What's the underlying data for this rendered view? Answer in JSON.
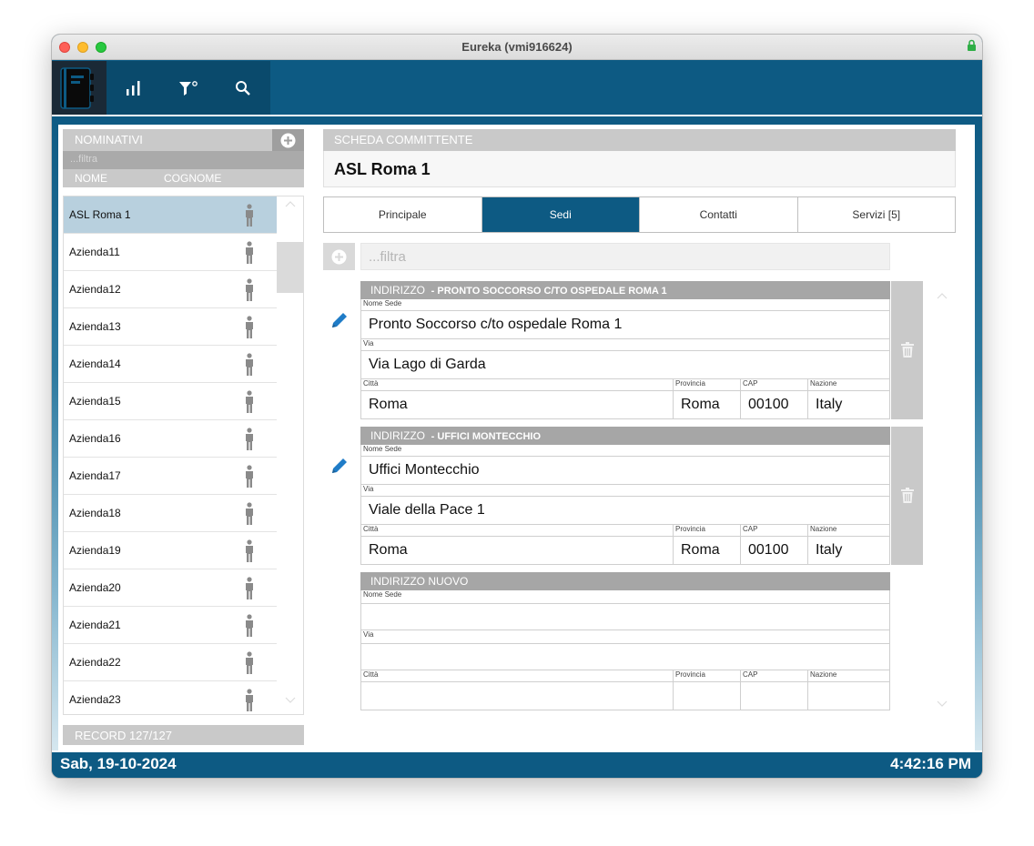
{
  "window": {
    "title": "Eureka (vmi916624)"
  },
  "toolbar": {
    "icons": [
      "notebook-icon",
      "bar-chart-icon",
      "filter-icon",
      "search-icon"
    ]
  },
  "left_panel": {
    "header": "NOMINATIVI",
    "filter_placeholder": "...filtra",
    "columns": [
      "NOME",
      "COGNOME"
    ],
    "rows": [
      "ASL Roma 1",
      "Azienda11",
      "Azienda12",
      "Azienda13",
      "Azienda14",
      "Azienda15",
      "Azienda16",
      "Azienda17",
      "Azienda18",
      "Azienda19",
      "Azienda20",
      "Azienda21",
      "Azienda22",
      "Azienda23"
    ],
    "selected": "ASL Roma 1",
    "record": "RECORD 127/127"
  },
  "detail": {
    "header": "SCHEDA COMMITTENTE",
    "name": "ASL Roma 1",
    "tabs": [
      "Principale",
      "Sedi",
      "Contatti",
      "Servizi [5]"
    ],
    "active_tab": "Sedi",
    "filter_placeholder": "...filtra",
    "labels": {
      "nome_sede": "Nome Sede",
      "via": "Via",
      "citta": "Città",
      "provincia": "Provincia",
      "cap": "CAP",
      "nazione": "Nazione"
    },
    "sedi": [
      {
        "head_prefix": "INDIRIZZO",
        "head_name": "- PRONTO SOCCORSO C/TO OSPEDALE ROMA 1",
        "nome_sede": "Pronto Soccorso c/to ospedale Roma 1",
        "via": "Via Lago di Garda",
        "citta": "Roma",
        "provincia": "Roma",
        "cap": "00100",
        "nazione": "Italy"
      },
      {
        "head_prefix": "INDIRIZZO",
        "head_name": "- UFFICI MONTECCHIO",
        "nome_sede": "Uffici Montecchio",
        "via": "Viale della Pace 1",
        "citta": "Roma",
        "provincia": "Roma",
        "cap": "00100",
        "nazione": "Italy"
      }
    ],
    "new_card_header": "INDIRIZZO NUOVO"
  },
  "status_bar": {
    "date": "Sab, 19-10-2024",
    "time": "4:42:16 PM"
  },
  "colors": {
    "brand": "#0d5a83",
    "selected_row": "#b8d0de",
    "header_gray": "#c9c9c9"
  }
}
